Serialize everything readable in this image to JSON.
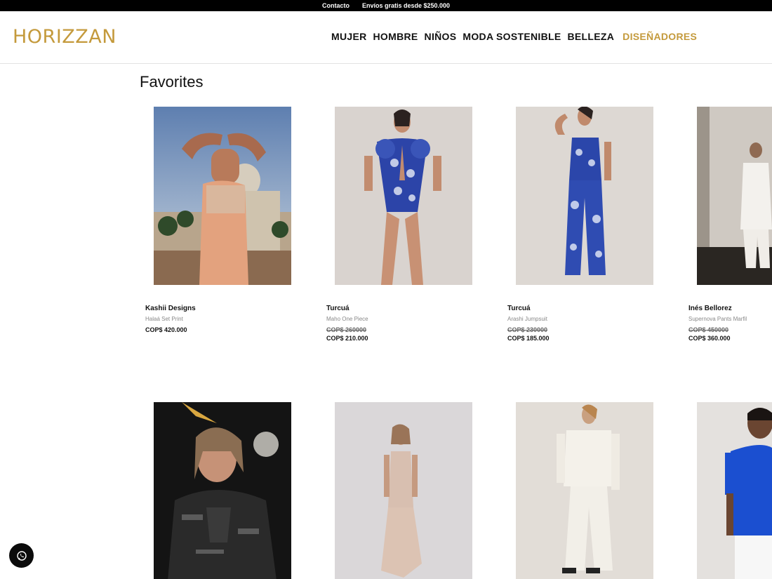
{
  "topbar": {
    "contact": "Contacto",
    "shipping": "Envíos gratis desde $250.000"
  },
  "brand": {
    "logo": "HORIZZAN",
    "color": "#c49a3c"
  },
  "nav": [
    "MUJER",
    "HOMBRE",
    "NIÑOS",
    "MODA SOSTENIBLE",
    "BELLEZA",
    "DISEÑADORES"
  ],
  "page_title": "Favorites",
  "products": [
    {
      "brand": "Kashii Designs",
      "name": "Halaá Set Print",
      "old_price": "",
      "price": "COP$ 420.000"
    },
    {
      "brand": "Turcuá",
      "name": "Maho One Piece",
      "old_price": "COP$ 260000",
      "price": "COP$ 210.000"
    },
    {
      "brand": "Turcuá",
      "name": "Arashi Jumpsuit",
      "old_price": "COP$ 230000",
      "price": "COP$ 185.000"
    },
    {
      "brand": "Inés Bellorez",
      "name": "Supernova Pants Marfil",
      "old_price": "COP$ 450000",
      "price": "COP$ 360.000"
    },
    {
      "brand": "",
      "name": "",
      "old_price": "",
      "price": ""
    },
    {
      "brand": "",
      "name": "",
      "old_price": "",
      "price": ""
    },
    {
      "brand": "",
      "name": "",
      "old_price": "",
      "price": ""
    },
    {
      "brand": "",
      "name": "",
      "old_price": "",
      "price": ""
    }
  ],
  "icons": {
    "whatsapp": "whatsapp-icon"
  }
}
